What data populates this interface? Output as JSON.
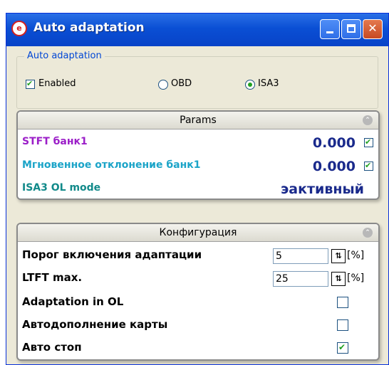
{
  "window": {
    "title": "Auto adaptation"
  },
  "group": {
    "legend": "Auto adaptation",
    "enabled": {
      "label": "Enabled",
      "checked": true
    },
    "mode_options": [
      {
        "label": "OBD",
        "selected": false
      },
      {
        "label": "ISA3",
        "selected": true
      }
    ]
  },
  "params": {
    "title": "Params",
    "rows": [
      {
        "label": "STFT банк1",
        "value": "0.000",
        "checked": true,
        "color": "#9b1ec8"
      },
      {
        "label": "Мгновенное отклонение банк1",
        "value": "0.000",
        "checked": true,
        "color": "#1ba4c8"
      },
      {
        "label": "ISA3 OL mode",
        "status": "эактивный",
        "color": "#128a8a"
      }
    ]
  },
  "config": {
    "title": "Конфигурация",
    "rows": [
      {
        "label": "Порог включения адаптации",
        "value": "5",
        "unit": "[%]"
      },
      {
        "label": "LTFT max.",
        "value": "25",
        "unit": "[%]"
      },
      {
        "label": "Adaptation in OL",
        "checked": false
      },
      {
        "label": "Автодополнение карты",
        "checked": false
      },
      {
        "label": "Авто стоп",
        "checked": true
      }
    ]
  },
  "colors": {
    "titlebar": "#0a4fd4",
    "window_bg": "#ece9d8",
    "value_text": "#1a2a8c",
    "legend_text": "#0046d5",
    "check_mark": "#21a121"
  }
}
